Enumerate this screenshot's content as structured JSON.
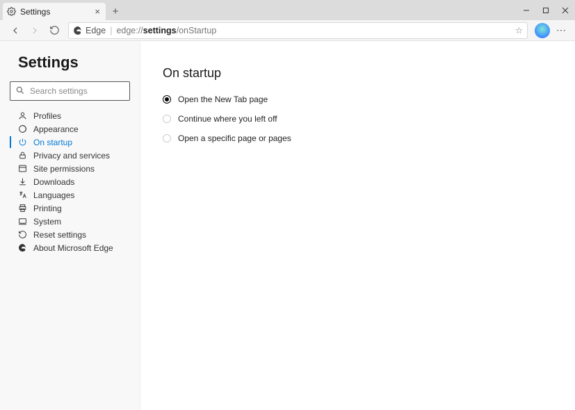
{
  "tab": {
    "title": "Settings"
  },
  "address": {
    "site_label": "Edge",
    "url_prefix": "edge://",
    "url_bold": "settings",
    "url_suffix": "/onStartup"
  },
  "sidebar": {
    "title": "Settings",
    "search_placeholder": "Search settings",
    "items": [
      {
        "label": "Profiles"
      },
      {
        "label": "Appearance"
      },
      {
        "label": "On startup"
      },
      {
        "label": "Privacy and services"
      },
      {
        "label": "Site permissions"
      },
      {
        "label": "Downloads"
      },
      {
        "label": "Languages"
      },
      {
        "label": "Printing"
      },
      {
        "label": "System"
      },
      {
        "label": "Reset settings"
      },
      {
        "label": "About Microsoft Edge"
      }
    ]
  },
  "main": {
    "heading": "On startup",
    "options": [
      {
        "label": "Open the New Tab page",
        "checked": true
      },
      {
        "label": "Continue where you left off",
        "checked": false
      },
      {
        "label": "Open a specific page or pages",
        "checked": false
      }
    ]
  }
}
